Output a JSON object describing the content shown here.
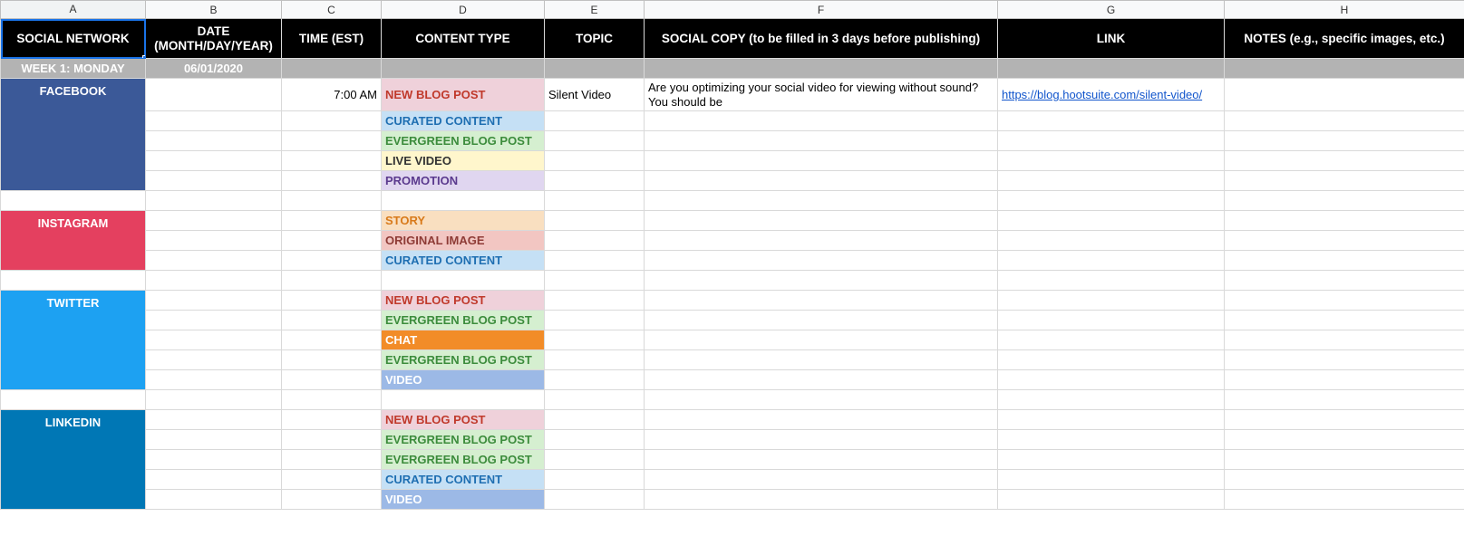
{
  "columns": [
    "A",
    "B",
    "C",
    "D",
    "E",
    "F",
    "G",
    "H"
  ],
  "headers": {
    "A": "SOCIAL NETWORK",
    "B": "DATE (MONTH/DAY/YEAR)",
    "C": "TIME (EST)",
    "D": "CONTENT TYPE",
    "E": "TOPIC",
    "F": "SOCIAL COPY (to be filled in 3 days before publishing)",
    "G": "LINK",
    "H": "NOTES (e.g., specific images, etc.)"
  },
  "week_row": {
    "label": "WEEK 1: MONDAY",
    "date": "06/01/2020"
  },
  "networks": {
    "facebook": "FACEBOOK",
    "instagram": "INSTAGRAM",
    "twitter": "TWITTER",
    "linkedin": "LINKEDIN"
  },
  "fb": {
    "time": "7:00 AM",
    "rows": [
      {
        "ct": "NEW BLOG POST",
        "topic": "Silent Video",
        "copy": "Are you optimizing your social video for viewing without sound? You should be",
        "link": "https://blog.hootsuite.com/silent-video/"
      },
      {
        "ct": "CURATED CONTENT"
      },
      {
        "ct": "EVERGREEN BLOG POST"
      },
      {
        "ct": "LIVE VIDEO"
      },
      {
        "ct": "PROMOTION"
      }
    ]
  },
  "ig": {
    "rows": [
      {
        "ct": "STORY"
      },
      {
        "ct": "ORIGINAL IMAGE"
      },
      {
        "ct": "CURATED CONTENT"
      }
    ]
  },
  "tw": {
    "rows": [
      {
        "ct": "NEW BLOG POST"
      },
      {
        "ct": "EVERGREEN BLOG POST"
      },
      {
        "ct": "CHAT"
      },
      {
        "ct": "EVERGREEN BLOG POST"
      },
      {
        "ct": "VIDEO"
      }
    ]
  },
  "li": {
    "rows": [
      {
        "ct": "NEW BLOG POST"
      },
      {
        "ct": "EVERGREEN BLOG POST"
      },
      {
        "ct": "EVERGREEN BLOG POST"
      },
      {
        "ct": "CURATED CONTENT"
      },
      {
        "ct": "VIDEO"
      }
    ]
  }
}
